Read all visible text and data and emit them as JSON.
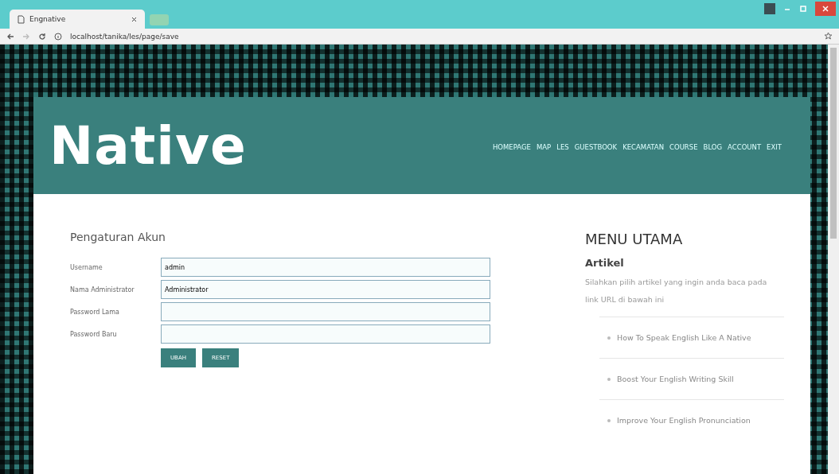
{
  "browser": {
    "tab_title": "Engnative",
    "url": "localhost/tanika/les/page/save"
  },
  "header": {
    "logo": "Native",
    "nav": [
      "HOMEPAGE",
      "MAP",
      "LES",
      "GUESTBOOK",
      "KECAMATAN",
      "COURSE",
      "BLOG",
      "ACCOUNT",
      "EXIT"
    ]
  },
  "form": {
    "title": "Pengaturan Akun",
    "fields": [
      {
        "label": "Username",
        "value": "admin"
      },
      {
        "label": "Nama Administrator",
        "value": "Administrator"
      },
      {
        "label": "Password Lama"
      },
      {
        "label": "Password Baru"
      }
    ],
    "buttons": [
      "UBAH",
      "RESET"
    ]
  },
  "sidebar": {
    "title": "MENU UTAMA",
    "subtitle": "Artikel",
    "description": "Silahkan pilih artikel yang ingin anda baca pada link URL di bawah ini",
    "articles": [
      "How To Speak English Like A Native",
      "Boost Your English Writing Skill",
      "Improve Your English Pronunciation"
    ]
  }
}
